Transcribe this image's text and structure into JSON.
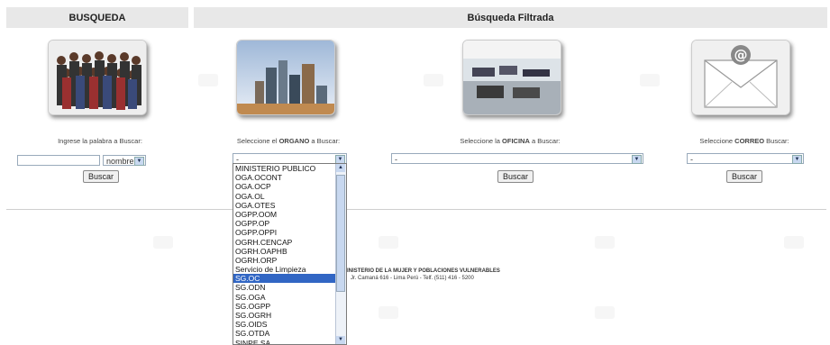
{
  "headers": {
    "left": "BUSQUEDA",
    "right": "Búsqueda Filtrada"
  },
  "search": {
    "label": "Ingrese la palabra a Buscar:",
    "input_value": "",
    "field_select": "nombre",
    "button": "Buscar"
  },
  "organo": {
    "label_pre": "Seleccione el ",
    "label_bold": "ORGANO",
    "label_post": " a Buscar:",
    "selected": "-",
    "options": [
      "MINISTERIO PUBLICO",
      "OGA.OCONT",
      "OGA.OCP",
      "OGA.OL",
      "OGA.OTES",
      "OGPP.OOM",
      "OGPP.OP",
      "OGPP.OPPI",
      "OGRH.CENCAP",
      "OGRH.OAPHB",
      "OGRH.ORP",
      "Servicio de Limpieza",
      "SG.OC",
      "SG.ODN",
      "SG.OGA",
      "SG.OGPP",
      "SG.OGRH",
      "SG.OIDS",
      "SG.OTDA",
      "SINPE SA"
    ],
    "highlighted": "SG.OC"
  },
  "oficina": {
    "label_pre": "Seleccione la ",
    "label_bold": "OFICINA",
    "label_post": " a Buscar:",
    "selected": "-",
    "button": "Buscar"
  },
  "correo": {
    "label_pre": "Seleccione ",
    "label_bold": "CORREO",
    "label_post": " Buscar:",
    "selected": "-",
    "button": "Buscar"
  },
  "footer": {
    "line1": "INISTERIO DE LA MUJER Y POBLACIONES VULNERABLES",
    "line2": "Jr. Camaná 616 - Lima Perú - Telf. (511) 416 - 5200"
  },
  "icons": [
    "people-photo-icon",
    "buildings-photo-icon",
    "office-photo-icon",
    "email-envelope-icon",
    "chevron-down-icon"
  ]
}
